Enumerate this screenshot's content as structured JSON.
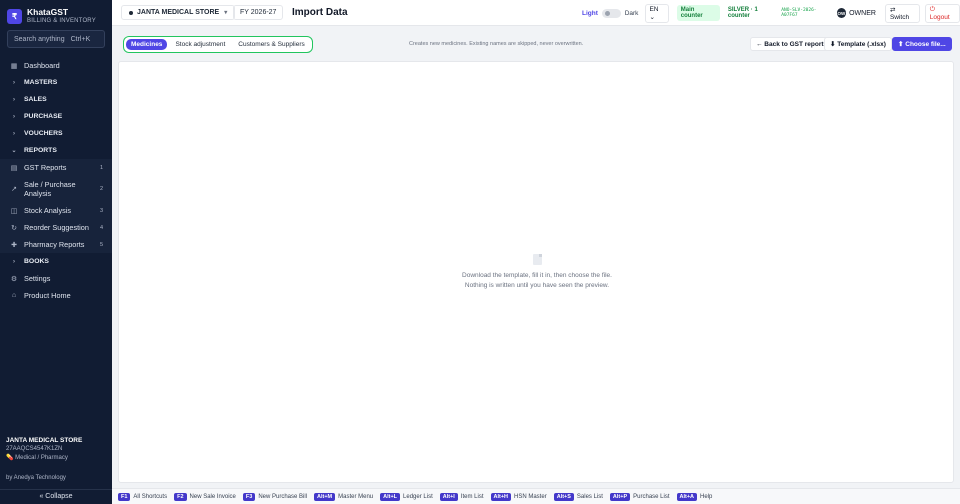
{
  "brand": {
    "logo": "₹",
    "name": "KhataGST",
    "subtitle": "BILLING & INVENTORY"
  },
  "sidebar": {
    "search_label": "Search anything",
    "search_shortcut": "Ctrl+K",
    "items": [
      {
        "label": "Dashboard",
        "icon": "grid-icon",
        "glyph": "▦"
      },
      {
        "label": "MASTERS",
        "icon": "chevron-right-icon",
        "glyph": "›"
      },
      {
        "label": "SALES",
        "icon": "chevron-right-icon",
        "glyph": "›"
      },
      {
        "label": "PURCHASE",
        "icon": "chevron-right-icon",
        "glyph": "›"
      },
      {
        "label": "VOUCHERS",
        "icon": "chevron-right-icon",
        "glyph": "›"
      },
      {
        "label": "REPORTS",
        "icon": "chevron-down-icon",
        "glyph": "⌄"
      },
      {
        "label": "GST Reports",
        "icon": "receipt-icon",
        "glyph": "▤",
        "badge": "1"
      },
      {
        "label": "Sale / Purchase Analysis",
        "icon": "trend-icon",
        "glyph": "↗",
        "badge": "2"
      },
      {
        "label": "Stock Analysis",
        "icon": "box-icon",
        "glyph": "◫",
        "badge": "3"
      },
      {
        "label": "Reorder Suggestion",
        "icon": "refresh-icon",
        "glyph": "↻",
        "badge": "4"
      },
      {
        "label": "Pharmacy Reports",
        "icon": "pill-icon",
        "glyph": "✚",
        "badge": "5"
      },
      {
        "label": "BOOKS",
        "icon": "chevron-right-icon",
        "glyph": "›"
      },
      {
        "label": "Settings",
        "icon": "gear-icon",
        "glyph": "⚙"
      },
      {
        "label": "Product Home",
        "icon": "home-icon",
        "glyph": "⌂"
      }
    ],
    "footer": {
      "store": "JANTA MEDICAL STORE",
      "gstin": "27AAQCS4547K1ZN",
      "type": "Medical / Pharmacy",
      "by": "by Anedya Technology"
    },
    "collapse": "« Collapse"
  },
  "header": {
    "store": "JANTA MEDICAL STORE",
    "fy": "FY 2026-27",
    "title": "Import Data",
    "theme_light": "Light",
    "theme_dark": "Dark",
    "lang": "EN",
    "counter": "Main counter",
    "plan": "SILVER · 1 counter",
    "plan_code": "ANO-SLV-2026-A07F67",
    "avatar": "OW",
    "role": "OWNER",
    "switch": "⇄ Switch",
    "logout": "⏻ Logout"
  },
  "toolbar": {
    "tabs": [
      {
        "label": "Medicines",
        "active": true
      },
      {
        "label": "Stock adjustment",
        "active": false
      },
      {
        "label": "Customers & Suppliers",
        "active": false
      }
    ],
    "note": "Creates new medicines. Existing names are skipped, never overwritten.",
    "back": "← Back to GST reports",
    "template": "⬇ Template (.xlsx)",
    "choose": "⬆ Choose file..."
  },
  "empty_state": {
    "line1": "Download the template, fill it in, then choose the file.",
    "line2": "Nothing is written until you have seen the preview."
  },
  "shortcuts": [
    {
      "key": "F1",
      "label": "All Shortcuts"
    },
    {
      "key": "F2",
      "label": "New Sale Invoice"
    },
    {
      "key": "F3",
      "label": "New Purchase Bill"
    },
    {
      "key": "Alt+M",
      "label": "Master Menu"
    },
    {
      "key": "Alt+L",
      "label": "Ledger List"
    },
    {
      "key": "Alt+I",
      "label": "Item List"
    },
    {
      "key": "Alt+H",
      "label": "HSN Master"
    },
    {
      "key": "Alt+S",
      "label": "Sales List"
    },
    {
      "key": "Alt+P",
      "label": "Purchase List"
    },
    {
      "key": "Alt+A",
      "label": "Help"
    }
  ],
  "colors": {
    "accent": "#4f46e5",
    "sidebar": "#111c33",
    "highlight": "#22c55e",
    "logout": "#dc2626"
  }
}
